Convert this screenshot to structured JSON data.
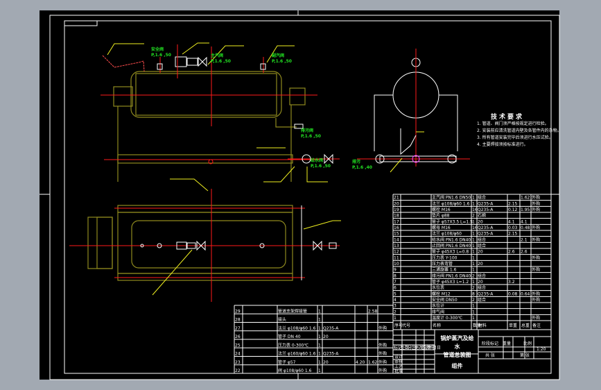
{
  "drawing": {
    "tech_requirements": {
      "heading": "技术要求",
      "items": [
        "1. 管道、阀门须严格按规定进行检验。",
        "2. 安装前应清洗管道内壁及各管件内的杂物。",
        "3. 所有管道安装完毕后须进行水压试验。",
        "4. 主要焊接须按标准进行。"
      ]
    },
    "callouts": [
      {
        "id": "safety-valve",
        "label": "安全阀",
        "spec": "P,1.6 ,50"
      },
      {
        "id": "main-valve",
        "label": "主汽阀",
        "spec": "P,1.6 ,50"
      },
      {
        "id": "secondary-valve",
        "label": "副汽阀",
        "spec": "P,1.6 ,50"
      },
      {
        "id": "drain-valve",
        "label": "排污阀",
        "spec": "P,1.6 ,50"
      },
      {
        "id": "feed-valve",
        "label": "给水阀",
        "spec": "P,1.6 ,50"
      },
      {
        "id": "side-valve",
        "label": "排污",
        "spec": "P,1.6 ,40"
      }
    ],
    "parts_list": {
      "header": [
        "序号",
        "代号",
        "名称",
        "数量",
        "材料",
        "单重",
        "总重",
        "备注"
      ],
      "rows": [
        [
          "21",
          "",
          "主汽阀 PN1.6 DN50",
          "1",
          "组合",
          "",
          "1.62",
          "外购"
        ],
        [
          "20",
          "",
          "法兰 φ108/φ60 1.6",
          "1",
          "Q235-A",
          "2.15",
          "",
          "外购"
        ],
        [
          "19",
          "",
          "螺栓 M16",
          "16",
          "Q235-A",
          "0.12",
          "1.95",
          "外购"
        ],
        [
          "18",
          "",
          "垫片 φ88",
          "2",
          "石棉",
          "",
          "",
          ""
        ],
        [
          "17",
          "",
          "管子 φ57X3.5 L=1.5",
          "1",
          "20",
          "4.1",
          "4.1",
          ""
        ],
        [
          "16",
          "",
          "螺母 M16",
          "16",
          "Q235-A",
          "0.03",
          "0.48",
          "外购"
        ],
        [
          "15",
          "",
          "法兰 φ108/φ60",
          "1",
          "Q235-A",
          "2.15",
          "",
          ""
        ],
        [
          "14",
          "",
          "给水阀 PN1.6 DN40",
          "1",
          "组合",
          "",
          "2.1",
          "外购"
        ],
        [
          "13",
          "",
          "止回阀 PN1.6 DN40",
          "1",
          "组合",
          "",
          "",
          ""
        ],
        [
          "12",
          "",
          "管子 φ45X3 L=0.8",
          "1",
          "20",
          "2.6",
          "2.6",
          ""
        ],
        [
          "11",
          "",
          "压力表 Y-100",
          "1",
          "",
          "",
          "",
          "外购"
        ],
        [
          "10",
          "",
          "压力表弯管",
          "1",
          "20",
          "",
          "",
          ""
        ],
        [
          "9",
          "",
          "三通旋塞 1.6",
          "1",
          "",
          "",
          "",
          "外购"
        ],
        [
          "8",
          "",
          "排污阀 PN1.6 DN40",
          "2",
          "组合",
          "",
          "",
          ""
        ],
        [
          "7",
          "",
          "管子 φ45X3 L=1.2",
          "1",
          "20",
          "3.2",
          "",
          ""
        ],
        [
          "6",
          "",
          "水位表",
          "2",
          "组合",
          "",
          "",
          ""
        ],
        [
          "5",
          "",
          "螺栓 M12",
          "8",
          "Q235-A",
          "0.08",
          "0.64",
          "外购"
        ],
        [
          "4",
          "",
          "安全阀 DN50",
          "2",
          "组合",
          "",
          "",
          "外购"
        ],
        [
          "3",
          "",
          "水位计",
          "1",
          "",
          "",
          "",
          ""
        ],
        [
          "2",
          "",
          "排气阀",
          "1",
          "",
          "",
          "",
          ""
        ],
        [
          "1",
          "",
          "温度计 0-300℃",
          "1",
          "",
          "",
          "",
          "外购"
        ]
      ],
      "left_rows": [
        [
          "29",
          "",
          "管道支架焊接管",
          "1",
          "",
          "",
          "2.58",
          ""
        ],
        [
          "28",
          "",
          "接头",
          "1",
          "",
          "",
          "",
          ""
        ],
        [
          "27",
          "",
          "法兰 φ108/φ60 1.6",
          "1",
          "Q235-A",
          "",
          "",
          "外购"
        ],
        [
          "26",
          "",
          "管子 DN 40",
          "1",
          "20",
          "",
          "",
          ""
        ],
        [
          "25",
          "",
          "压力表 0-300℃",
          "1",
          "",
          "",
          "",
          "外购"
        ],
        [
          "24",
          "",
          "法兰 φ160/φ60 1.6",
          "1",
          "Q235-A",
          "",
          "",
          "外购"
        ],
        [
          "23",
          "",
          "管子 φ57",
          "1",
          "20",
          "4.20",
          "1.62",
          "外购"
        ],
        [
          "22",
          "",
          "阀 φ108/φ60 1.6",
          "1",
          "",
          "",
          "",
          "外购"
        ]
      ]
    },
    "title_block": {
      "title_line1": "锅炉蒸汽及给水",
      "title_line2": "管道总装图",
      "material_label": "组件",
      "fields": [
        "标记",
        "处数",
        "分区",
        "更改文件号",
        "签名",
        "年月日"
      ],
      "roles": [
        "设计",
        "审核",
        "工艺",
        "批准"
      ],
      "stage_labels": [
        "阶段标记",
        "重量",
        "比例"
      ],
      "scale": "1:20",
      "sheet": [
        "共 张",
        "第 张"
      ]
    }
  },
  "colors": {
    "background": "#000000",
    "frame": "#ffffff",
    "vessel": "#8f8a1e",
    "centerline": "#ff1a1a",
    "leader": "#f0f020",
    "spec_text": "#22e022"
  }
}
